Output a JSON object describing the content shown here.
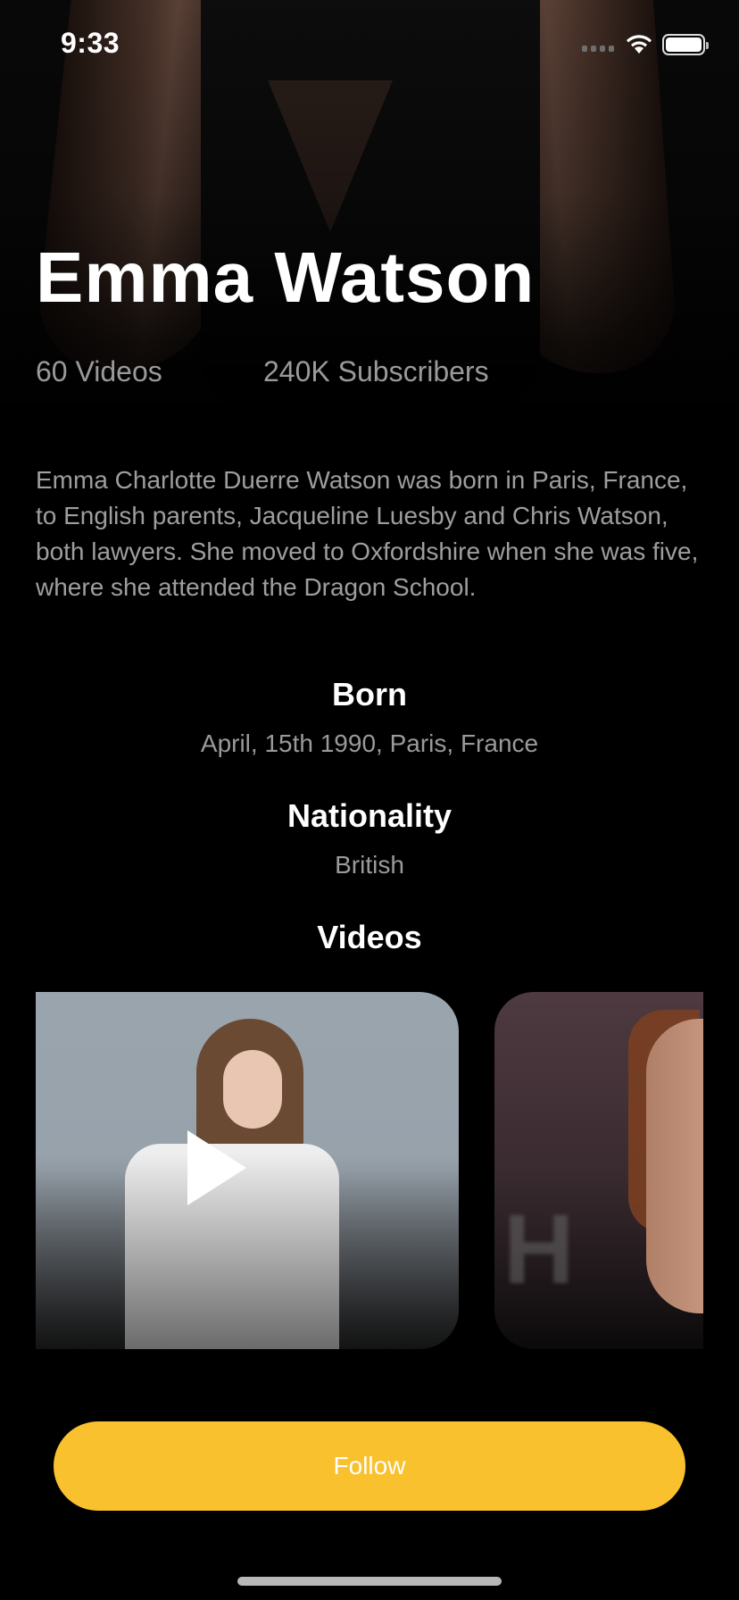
{
  "status_bar": {
    "time": "9:33"
  },
  "profile": {
    "name": "Emma Watson",
    "videos_count": "60 Videos",
    "subscribers": "240K Subscribers",
    "bio": "Emma Charlotte Duerre Watson was born in Paris, France, to English parents, Jacqueline Luesby and Chris Watson, both lawyers. She moved to Oxfordshire when she was five, where she attended the Dragon School."
  },
  "born": {
    "label": "Born",
    "value": "April, 15th 1990, Paris, France"
  },
  "nationality": {
    "label": "Nationality",
    "value": "British"
  },
  "videos": {
    "label": "Videos"
  },
  "follow_label": "Follow",
  "colors": {
    "accent": "#f9c12e",
    "background": "#000000"
  },
  "icons": [
    "signal-icon",
    "wifi-icon",
    "battery-icon",
    "play-icon"
  ]
}
